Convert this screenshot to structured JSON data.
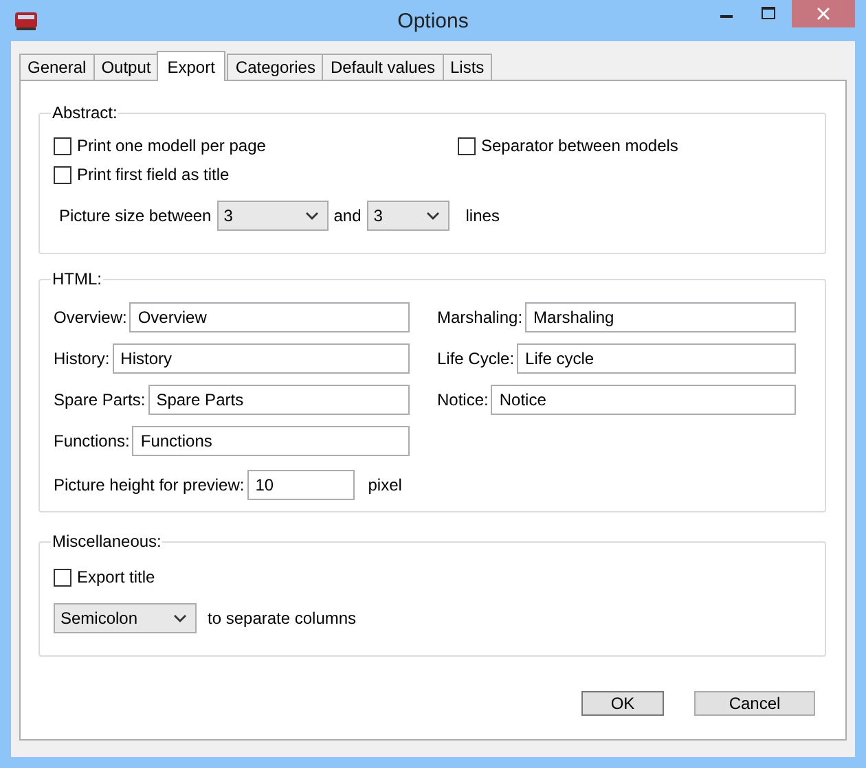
{
  "window": {
    "title": "Options"
  },
  "tabs": [
    {
      "label": "General",
      "selected": false
    },
    {
      "label": "Output",
      "selected": false
    },
    {
      "label": "Export",
      "selected": true
    },
    {
      "label": "Categories",
      "selected": false
    },
    {
      "label": "Default values",
      "selected": false
    },
    {
      "label": "Lists",
      "selected": false
    }
  ],
  "abstract": {
    "title": "Abstract:",
    "checkboxes": [
      {
        "label": "Print one modell per page",
        "checked": false
      },
      {
        "label": "Separator between models",
        "checked": false
      },
      {
        "label": "Print first field as title",
        "checked": false
      }
    ],
    "picture_size": {
      "label": "Picture size between",
      "from": "3",
      "and": "and",
      "to": "3",
      "unit": "lines"
    }
  },
  "html": {
    "title": "HTML:",
    "left_fields": [
      {
        "label": "Overview:",
        "value": "Overview"
      },
      {
        "label": "History:",
        "value": "History"
      },
      {
        "label": "Spare Parts:",
        "value": "Spare Parts"
      },
      {
        "label": "Functions:",
        "value": "Functions"
      }
    ],
    "right_fields": [
      {
        "label": "Marshaling:",
        "value": "Marshaling"
      },
      {
        "label": "Life Cycle:",
        "value": "Life cycle"
      },
      {
        "label": "Notice:",
        "value": "Notice"
      }
    ],
    "preview": {
      "label": "Picture height for preview:",
      "value": "10",
      "unit": "pixel"
    }
  },
  "miscellaneous": {
    "title": "Miscellaneous:",
    "export_title": {
      "label": "Export title",
      "checked": false
    },
    "separator": {
      "value": "Semicolon",
      "label": "to separate columns"
    }
  },
  "buttons": [
    "OK",
    "Cancel"
  ]
}
